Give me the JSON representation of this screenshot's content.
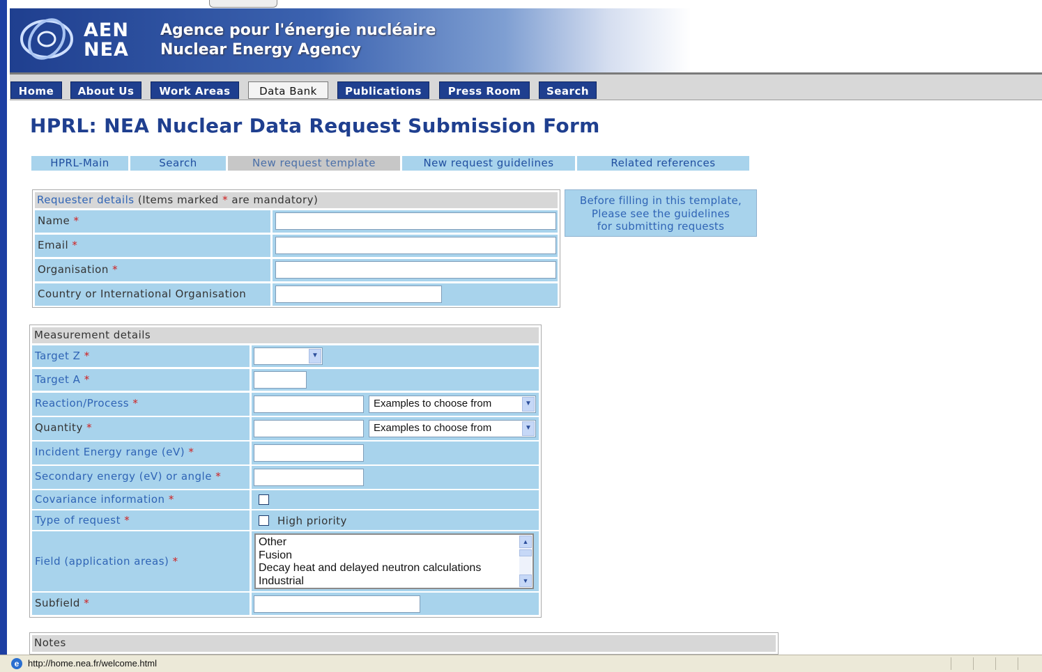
{
  "header": {
    "logo_line1": "AEN",
    "logo_line2": "NEA",
    "agency_fr": "Agence pour l'énergie nucléaire",
    "agency_en": "Nuclear Energy Agency"
  },
  "nav": {
    "tabs": [
      {
        "label": "Home"
      },
      {
        "label": "About Us"
      },
      {
        "label": "Work Areas"
      },
      {
        "label": "Data Bank",
        "active": true
      },
      {
        "label": "Publications"
      },
      {
        "label": "Press Room"
      },
      {
        "label": "Search"
      }
    ]
  },
  "page_title": "HPRL: NEA Nuclear Data Request Submission Form",
  "subnav": {
    "tabs": [
      {
        "label": "HPRL-Main"
      },
      {
        "label": "Search"
      },
      {
        "label": "New request template",
        "active": true
      },
      {
        "label": "New request guidelines"
      },
      {
        "label": "Related references"
      }
    ]
  },
  "requester": {
    "header_link": "Requester details",
    "header_rest_1": "(Items marked",
    "header_rest_2": "are mandatory)",
    "required_mark": "*",
    "fields": [
      {
        "label": "Name",
        "required": true,
        "value": ""
      },
      {
        "label": "Email",
        "required": true,
        "value": ""
      },
      {
        "label": "Organisation",
        "required": true,
        "value": ""
      },
      {
        "label": "Country or International Organisation",
        "required": false,
        "value": ""
      }
    ]
  },
  "guidelines_note": {
    "line1": "Before filling in this template,",
    "line2": "Please see the guidelines",
    "line3": "for submitting requests"
  },
  "measurement": {
    "header": "Measurement details",
    "required_mark": "*",
    "target_z": {
      "label": "Target Z",
      "selected": ""
    },
    "target_a": {
      "label": "Target A",
      "value": ""
    },
    "reaction": {
      "label": "Reaction/Process",
      "value": "",
      "examples": "Examples to choose from"
    },
    "quantity": {
      "label": "Quantity",
      "value": "",
      "examples": "Examples to choose from"
    },
    "incident_energy": {
      "label": "Incident Energy range (eV)",
      "value": ""
    },
    "secondary_energy": {
      "label": "Secondary energy (eV) or angle",
      "value": ""
    },
    "covariance": {
      "label": "Covariance information",
      "checked": false
    },
    "type_of_request": {
      "label": "Type of request",
      "option": "High priority",
      "checked": false
    },
    "field": {
      "label": "Field (application areas)",
      "options": [
        "Other",
        "Fusion",
        "Decay heat and delayed neutron calculations",
        "Industrial"
      ]
    },
    "subfield": {
      "label": "Subfield",
      "value": ""
    }
  },
  "notes": {
    "header": "Notes"
  },
  "status": {
    "url": "http://home.nea.fr/welcome.html"
  },
  "colors": {
    "brand_blue": "#1f3f8f",
    "cell_blue": "#a8d3ec",
    "required_red": "#d02020",
    "header_grey": "#d7d7d7"
  }
}
